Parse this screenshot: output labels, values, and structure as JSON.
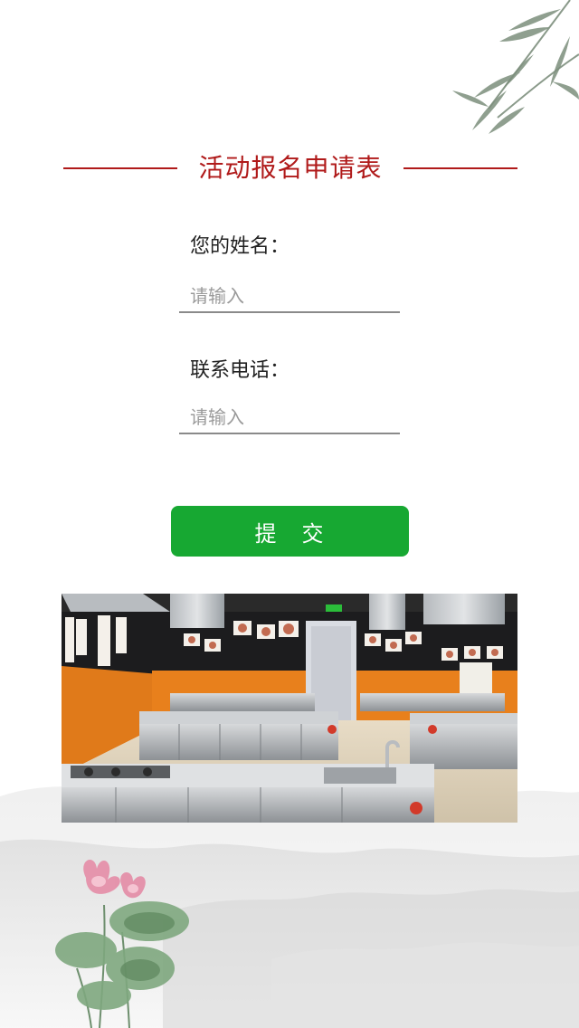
{
  "header": {
    "title": "活动报名申请表"
  },
  "form": {
    "name": {
      "label": "您的姓名：",
      "placeholder": "请输入",
      "value": ""
    },
    "phone": {
      "label": "联系电话：",
      "placeholder": "请输入",
      "value": ""
    },
    "submit_label": "提　交"
  },
  "colors": {
    "accent_red": "#b01a1a",
    "button_green": "#17a832"
  },
  "decorations": {
    "top_right": "bamboo-icon",
    "bottom_left": "lotus-icon",
    "photo": "kitchen-classroom-photo"
  }
}
